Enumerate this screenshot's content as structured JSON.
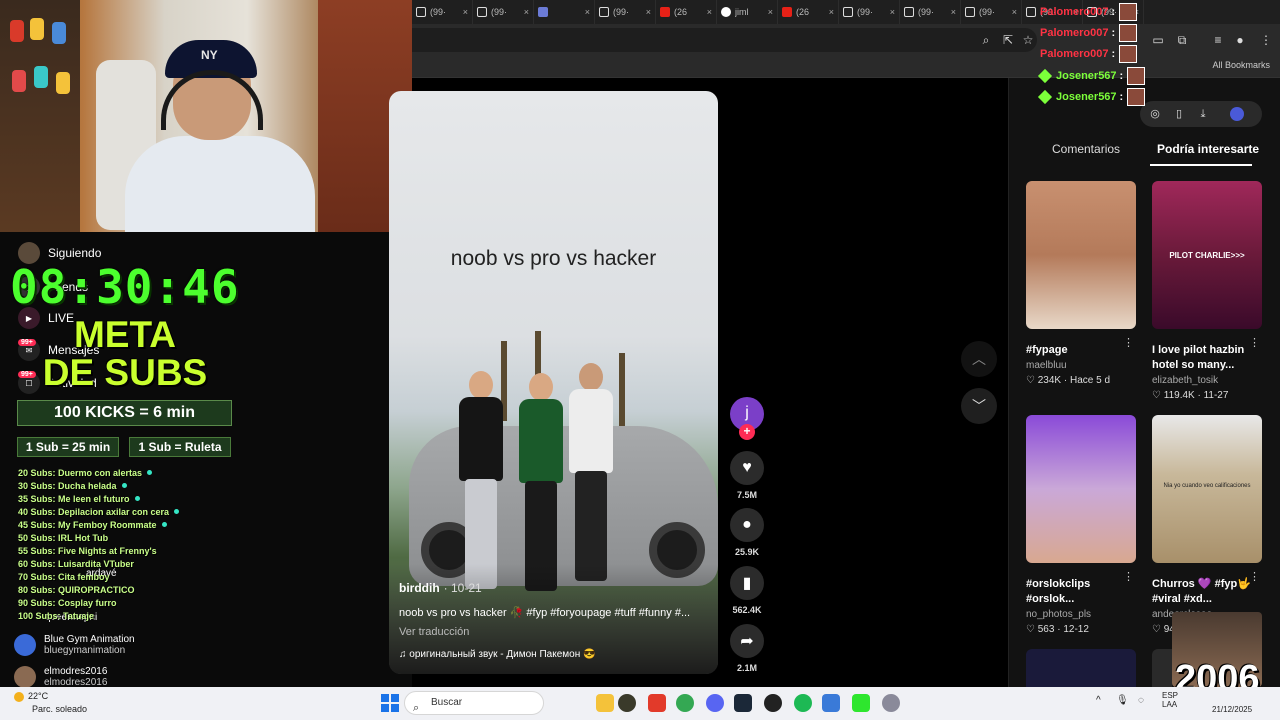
{
  "browser": {
    "tabs": [
      {
        "icon": "tiktok",
        "title": "(99·"
      },
      {
        "icon": "tiktok",
        "title": "(99·"
      },
      {
        "icon": "window",
        "title": ""
      },
      {
        "icon": "tiktok",
        "title": "(99·"
      },
      {
        "icon": "youtube",
        "title": "(26"
      },
      {
        "icon": "google",
        "title": "jiml"
      },
      {
        "icon": "youtube",
        "title": "(26"
      },
      {
        "icon": "tiktok",
        "title": "(99·"
      },
      {
        "icon": "tiktok",
        "title": "(99·"
      },
      {
        "icon": "tiktok",
        "title": "(99·"
      },
      {
        "icon": "tiktok",
        "title": "(99·"
      },
      {
        "icon": "tiktok",
        "title": "(99·"
      }
    ],
    "all_bookmarks": "All Bookmarks"
  },
  "overlay": {
    "timer": "08:30:46",
    "meta_line1": "META",
    "meta_line2": "DE SUBS",
    "kicks": "100 KICKS = 6 min",
    "sub_time": "1 Sub = 25 min",
    "sub_ruleta": "1 Sub = Ruleta",
    "goals": [
      "20 Subs: Duermo con alertas",
      "30 Subs: Ducha helada",
      "35 Subs: Me leen el futuro",
      "40 Subs: Depilacion axilar con cera",
      "45 Subs: My Femboy Roommate",
      "50 Subs: IRL Hot Tub",
      "55 Subs: Five Nights at Frenny's",
      "60 Subs: Luisardita VTuber",
      "70 Subs: Cita femboy",
      "80 Subs: QUIROPRACTICO",
      "90 Subs: Cosplay furro",
      "100 Subs: Tatuaje"
    ]
  },
  "webcam": {
    "cap_logo": "NY"
  },
  "tiktok_nav": {
    "siguiendo": "Siguiendo",
    "friends": "Friends",
    "live": "LIVE",
    "mensajes": "Mensajes",
    "actividad": "Actividad",
    "badge": "99+",
    "following": [
      {
        "name": "ardavé",
        "handle": ""
      },
      {
        "name": "queennepni",
        "handle": ""
      },
      {
        "name": "Blue Gym Animation",
        "handle": "bluegymanimation"
      },
      {
        "name": "elmodres2016",
        "handle": "elmodres2016"
      }
    ]
  },
  "video": {
    "title": "noob vs pro vs hacker",
    "author": "birddih",
    "date": "· 10-21",
    "caption": "noob vs pro vs hacker 🥀 #fyp #foryoupage #tuff #funny #...",
    "translate": "Ver traducción",
    "music": "♫  оригинальный звук - Димон Пакемон 😎",
    "avatar_letter": "j",
    "likes": "7.5M",
    "comments": "25.9K",
    "saves": "562.4K",
    "shares": "2.1M"
  },
  "right_panel": {
    "tab_comments": "Comentarios",
    "tab_interest": "Podría interesarte",
    "cards": [
      {
        "caption": "#fypage",
        "author": "maelbluu",
        "likes": "234K",
        "date": "· Hace 5 d",
        "thumb_text": ""
      },
      {
        "caption": "I love pilot hazbin hotel so many...",
        "author": "elizabeth_tosik",
        "likes": "119.4K",
        "date": "· 11-27",
        "thumb_text": "PILOT CHARLIE>>>"
      },
      {
        "caption": "#orslokclips #orslok...",
        "author": "no_photos_pls",
        "likes": "563",
        "date": "· 12-12",
        "thumb_text": ""
      },
      {
        "caption": "Churros 💜 #fyp🤟 #viral #xd...",
        "author": "andeorcloseo",
        "likes": "94",
        "date": "",
        "thumb_text": "Nia yo cuando veo calificaciones"
      }
    ]
  },
  "chat": [
    {
      "user": "Palomero007",
      "sep": ":",
      "color": "#ff3344"
    },
    {
      "user": "Palomero007",
      "sep": ":",
      "color": "#ff3344"
    },
    {
      "user": "Palomero007",
      "sep": ":",
      "color": "#ff3344"
    },
    {
      "user": "Josener567",
      "sep": ":",
      "color": "#7cff3a"
    },
    {
      "user": "Josener567",
      "sep": ":",
      "color": "#7cff3a"
    }
  ],
  "cam2_text": "2006",
  "taskbar": {
    "temp": "22°C",
    "weather": "Parc. soleado",
    "search": "Buscar",
    "lang": "ESP",
    "lang2": "LAA",
    "date": "21/12/2025"
  },
  "colors": {
    "accent": "#fe2c55",
    "timer": "#4cff2e",
    "meta": "#c9ff2e"
  }
}
